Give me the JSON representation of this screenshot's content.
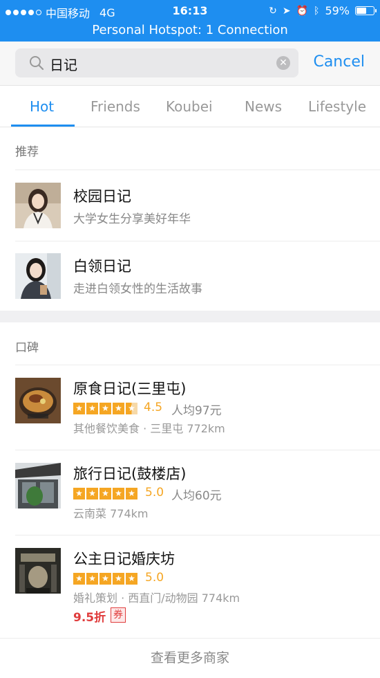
{
  "status_bar": {
    "carrier": "中国移动",
    "network": "4G",
    "time": "16:13",
    "battery": "59%",
    "battery_level": 0.59,
    "bg_color": "#1e8ef0"
  },
  "hotspot_banner": "Personal Hotspot: 1 Connection",
  "search": {
    "query": "日记",
    "cancel_label": "Cancel"
  },
  "tabs": [
    {
      "label": "Hot",
      "active": true
    },
    {
      "label": "Friends",
      "active": false
    },
    {
      "label": "Koubei",
      "active": false
    },
    {
      "label": "News",
      "active": false
    },
    {
      "label": "Lifestyle",
      "active": false
    }
  ],
  "recommend": {
    "header": "推荐",
    "items": [
      {
        "title": "校园日记",
        "subtitle": "大学女生分享美好年华"
      },
      {
        "title": "白领日记",
        "subtitle": "走进白领女性的生活故事"
      }
    ]
  },
  "koubei": {
    "header": "口碑",
    "items": [
      {
        "title": "原食日记(三里屯)",
        "rating": "4.5",
        "rating_value": 4.5,
        "price": "人均97元",
        "meta": "其他餐饮美食 · 三里屯 772km"
      },
      {
        "title": "旅行日记(鼓楼店)",
        "rating": "5.0",
        "rating_value": 5.0,
        "price": "人均60元",
        "meta": "云南菜 774km"
      },
      {
        "title": "公主日记婚庆坊",
        "rating": "5.0",
        "rating_value": 5.0,
        "price": "",
        "meta": "婚礼策划 · 西直门/动物园 774km",
        "discount": "9.5折",
        "coupon": "券"
      }
    ],
    "more_label": "查看更多商家"
  },
  "colors": {
    "accent": "#1e8ef0",
    "star": "#f5a623",
    "discount": "#e03c3c"
  }
}
